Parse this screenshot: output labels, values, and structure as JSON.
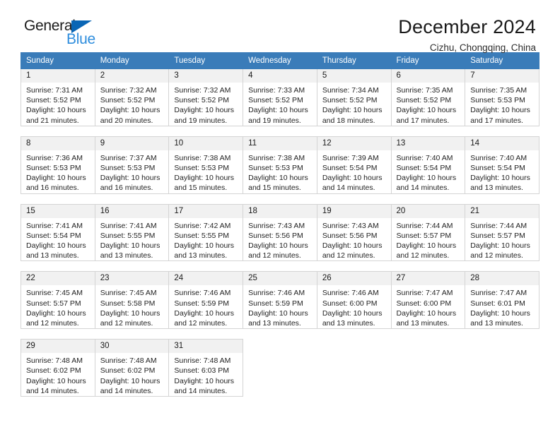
{
  "brand": {
    "name_top": "General",
    "name_bottom": "Blue",
    "accent_color": "#0a66b5",
    "accent_light": "#2e8ddd"
  },
  "header": {
    "title": "December 2024",
    "subtitle": "Cizhu, Chongqing, China"
  },
  "theme": {
    "header_bar_color": "#3a7cb9",
    "daynum_bg": "#f1f1f1",
    "cell_border": "#d4d4d4"
  },
  "weekday_headers": [
    "Sunday",
    "Monday",
    "Tuesday",
    "Wednesday",
    "Thursday",
    "Friday",
    "Saturday"
  ],
  "weeks": [
    {
      "days": [
        {
          "num": "1",
          "sunrise": "Sunrise: 7:31 AM",
          "sunset": "Sunset: 5:52 PM",
          "daylight_1": "Daylight: 10 hours",
          "daylight_2": "and 21 minutes."
        },
        {
          "num": "2",
          "sunrise": "Sunrise: 7:32 AM",
          "sunset": "Sunset: 5:52 PM",
          "daylight_1": "Daylight: 10 hours",
          "daylight_2": "and 20 minutes."
        },
        {
          "num": "3",
          "sunrise": "Sunrise: 7:32 AM",
          "sunset": "Sunset: 5:52 PM",
          "daylight_1": "Daylight: 10 hours",
          "daylight_2": "and 19 minutes."
        },
        {
          "num": "4",
          "sunrise": "Sunrise: 7:33 AM",
          "sunset": "Sunset: 5:52 PM",
          "daylight_1": "Daylight: 10 hours",
          "daylight_2": "and 19 minutes."
        },
        {
          "num": "5",
          "sunrise": "Sunrise: 7:34 AM",
          "sunset": "Sunset: 5:52 PM",
          "daylight_1": "Daylight: 10 hours",
          "daylight_2": "and 18 minutes."
        },
        {
          "num": "6",
          "sunrise": "Sunrise: 7:35 AM",
          "sunset": "Sunset: 5:52 PM",
          "daylight_1": "Daylight: 10 hours",
          "daylight_2": "and 17 minutes."
        },
        {
          "num": "7",
          "sunrise": "Sunrise: 7:35 AM",
          "sunset": "Sunset: 5:53 PM",
          "daylight_1": "Daylight: 10 hours",
          "daylight_2": "and 17 minutes."
        }
      ]
    },
    {
      "days": [
        {
          "num": "8",
          "sunrise": "Sunrise: 7:36 AM",
          "sunset": "Sunset: 5:53 PM",
          "daylight_1": "Daylight: 10 hours",
          "daylight_2": "and 16 minutes."
        },
        {
          "num": "9",
          "sunrise": "Sunrise: 7:37 AM",
          "sunset": "Sunset: 5:53 PM",
          "daylight_1": "Daylight: 10 hours",
          "daylight_2": "and 16 minutes."
        },
        {
          "num": "10",
          "sunrise": "Sunrise: 7:38 AM",
          "sunset": "Sunset: 5:53 PM",
          "daylight_1": "Daylight: 10 hours",
          "daylight_2": "and 15 minutes."
        },
        {
          "num": "11",
          "sunrise": "Sunrise: 7:38 AM",
          "sunset": "Sunset: 5:53 PM",
          "daylight_1": "Daylight: 10 hours",
          "daylight_2": "and 15 minutes."
        },
        {
          "num": "12",
          "sunrise": "Sunrise: 7:39 AM",
          "sunset": "Sunset: 5:54 PM",
          "daylight_1": "Daylight: 10 hours",
          "daylight_2": "and 14 minutes."
        },
        {
          "num": "13",
          "sunrise": "Sunrise: 7:40 AM",
          "sunset": "Sunset: 5:54 PM",
          "daylight_1": "Daylight: 10 hours",
          "daylight_2": "and 14 minutes."
        },
        {
          "num": "14",
          "sunrise": "Sunrise: 7:40 AM",
          "sunset": "Sunset: 5:54 PM",
          "daylight_1": "Daylight: 10 hours",
          "daylight_2": "and 13 minutes."
        }
      ]
    },
    {
      "days": [
        {
          "num": "15",
          "sunrise": "Sunrise: 7:41 AM",
          "sunset": "Sunset: 5:54 PM",
          "daylight_1": "Daylight: 10 hours",
          "daylight_2": "and 13 minutes."
        },
        {
          "num": "16",
          "sunrise": "Sunrise: 7:41 AM",
          "sunset": "Sunset: 5:55 PM",
          "daylight_1": "Daylight: 10 hours",
          "daylight_2": "and 13 minutes."
        },
        {
          "num": "17",
          "sunrise": "Sunrise: 7:42 AM",
          "sunset": "Sunset: 5:55 PM",
          "daylight_1": "Daylight: 10 hours",
          "daylight_2": "and 13 minutes."
        },
        {
          "num": "18",
          "sunrise": "Sunrise: 7:43 AM",
          "sunset": "Sunset: 5:56 PM",
          "daylight_1": "Daylight: 10 hours",
          "daylight_2": "and 12 minutes."
        },
        {
          "num": "19",
          "sunrise": "Sunrise: 7:43 AM",
          "sunset": "Sunset: 5:56 PM",
          "daylight_1": "Daylight: 10 hours",
          "daylight_2": "and 12 minutes."
        },
        {
          "num": "20",
          "sunrise": "Sunrise: 7:44 AM",
          "sunset": "Sunset: 5:57 PM",
          "daylight_1": "Daylight: 10 hours",
          "daylight_2": "and 12 minutes."
        },
        {
          "num": "21",
          "sunrise": "Sunrise: 7:44 AM",
          "sunset": "Sunset: 5:57 PM",
          "daylight_1": "Daylight: 10 hours",
          "daylight_2": "and 12 minutes."
        }
      ]
    },
    {
      "days": [
        {
          "num": "22",
          "sunrise": "Sunrise: 7:45 AM",
          "sunset": "Sunset: 5:57 PM",
          "daylight_1": "Daylight: 10 hours",
          "daylight_2": "and 12 minutes."
        },
        {
          "num": "23",
          "sunrise": "Sunrise: 7:45 AM",
          "sunset": "Sunset: 5:58 PM",
          "daylight_1": "Daylight: 10 hours",
          "daylight_2": "and 12 minutes."
        },
        {
          "num": "24",
          "sunrise": "Sunrise: 7:46 AM",
          "sunset": "Sunset: 5:59 PM",
          "daylight_1": "Daylight: 10 hours",
          "daylight_2": "and 12 minutes."
        },
        {
          "num": "25",
          "sunrise": "Sunrise: 7:46 AM",
          "sunset": "Sunset: 5:59 PM",
          "daylight_1": "Daylight: 10 hours",
          "daylight_2": "and 13 minutes."
        },
        {
          "num": "26",
          "sunrise": "Sunrise: 7:46 AM",
          "sunset": "Sunset: 6:00 PM",
          "daylight_1": "Daylight: 10 hours",
          "daylight_2": "and 13 minutes."
        },
        {
          "num": "27",
          "sunrise": "Sunrise: 7:47 AM",
          "sunset": "Sunset: 6:00 PM",
          "daylight_1": "Daylight: 10 hours",
          "daylight_2": "and 13 minutes."
        },
        {
          "num": "28",
          "sunrise": "Sunrise: 7:47 AM",
          "sunset": "Sunset: 6:01 PM",
          "daylight_1": "Daylight: 10 hours",
          "daylight_2": "and 13 minutes."
        }
      ]
    },
    {
      "days": [
        {
          "num": "29",
          "sunrise": "Sunrise: 7:48 AM",
          "sunset": "Sunset: 6:02 PM",
          "daylight_1": "Daylight: 10 hours",
          "daylight_2": "and 14 minutes."
        },
        {
          "num": "30",
          "sunrise": "Sunrise: 7:48 AM",
          "sunset": "Sunset: 6:02 PM",
          "daylight_1": "Daylight: 10 hours",
          "daylight_2": "and 14 minutes."
        },
        {
          "num": "31",
          "sunrise": "Sunrise: 7:48 AM",
          "sunset": "Sunset: 6:03 PM",
          "daylight_1": "Daylight: 10 hours",
          "daylight_2": "and 14 minutes."
        },
        null,
        null,
        null,
        null
      ]
    }
  ]
}
